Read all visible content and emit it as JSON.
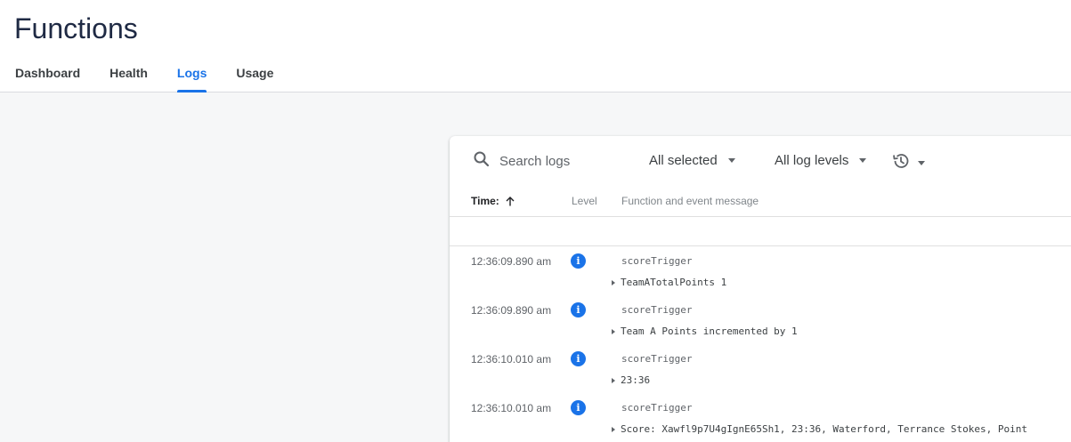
{
  "page": {
    "title": "Functions",
    "accent_color": "#1a73e8"
  },
  "tabs": [
    {
      "label": "Dashboard",
      "active": false
    },
    {
      "label": "Health",
      "active": false
    },
    {
      "label": "Logs",
      "active": true
    },
    {
      "label": "Usage",
      "active": false
    }
  ],
  "logs_panel": {
    "search": {
      "icon": "search-icon",
      "placeholder": "Search logs"
    },
    "function_filter": {
      "label": "All selected",
      "icon": "chevron-down-icon"
    },
    "level_filter": {
      "label": "All log levels",
      "icon": "chevron-down-icon"
    },
    "history": {
      "icon": "history-icon"
    },
    "columns": {
      "time": "Time:",
      "time_sort_icon": "arrow-up-icon",
      "level": "Level",
      "message": "Function and event message"
    },
    "rows": [
      {
        "time": "12:36:09.890 am",
        "level": "info",
        "level_icon": "info-icon",
        "function": "scoreTrigger",
        "message": "TeamATotalPoints 1"
      },
      {
        "time": "12:36:09.890 am",
        "level": "info",
        "level_icon": "info-icon",
        "function": "scoreTrigger",
        "message": "Team A Points incremented by 1"
      },
      {
        "time": "12:36:10.010 am",
        "level": "info",
        "level_icon": "info-icon",
        "function": "scoreTrigger",
        "message": "23:36"
      },
      {
        "time": "12:36:10.010 am",
        "level": "info",
        "level_icon": "info-icon",
        "function": "scoreTrigger",
        "message": "Score: Xawfl9p7U4gIgnE65Sh1, 23:36, Waterford, Terrance Stokes, Point"
      }
    ]
  }
}
